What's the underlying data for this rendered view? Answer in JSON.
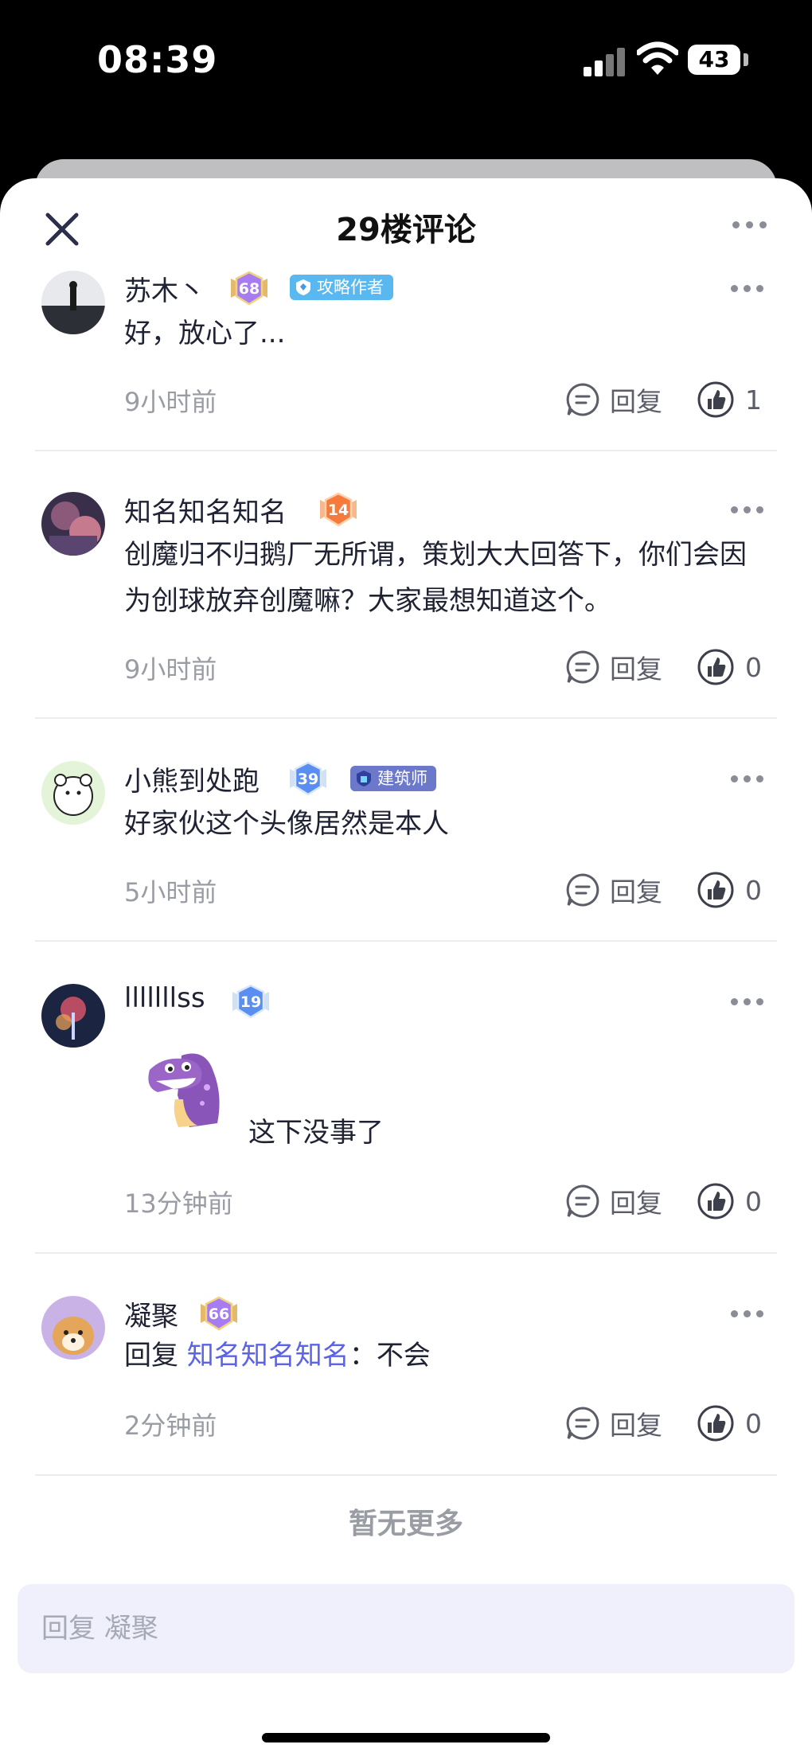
{
  "status_bar": {
    "time": "08:39",
    "battery": "43"
  },
  "header": {
    "title": "29楼评论"
  },
  "comments": [
    {
      "username": "苏木丶",
      "level": "68",
      "tag": "攻略作者",
      "text": "好，放心了...",
      "time": "9小时前",
      "reply_label": "回复",
      "likes": "1"
    },
    {
      "username": "知名知名知名",
      "level": "14",
      "text": "创魔归不归鹅厂无所谓，策划大大回答下，你们会因为创球放弃创魔嘛？大家最想知道这个。",
      "time": "9小时前",
      "reply_label": "回复",
      "likes": "0"
    },
    {
      "username": "小熊到处跑",
      "level": "39",
      "tag": "建筑师",
      "text": "好家伙这个头像居然是本人",
      "time": "5小时前",
      "reply_label": "回复",
      "likes": "0"
    },
    {
      "username": "lllllllss",
      "level": "19",
      "text": "这下没事了",
      "time": "13分钟前",
      "reply_label": "回复",
      "likes": "0"
    },
    {
      "username": "凝聚",
      "level": "66",
      "reply_prefix": "回复",
      "reply_to": "知名知名知名",
      "reply_sep": "：",
      "text": "不会",
      "time": "2分钟前",
      "reply_label": "回复",
      "likes": "0"
    }
  ],
  "footer": {
    "no_more": "暂无更多",
    "input_placeholder": "回复 凝聚"
  },
  "colors": {
    "accent": "#5b63e8",
    "tag_blue": "#5ab8f0",
    "level_purple": "#a77cf0",
    "level_orange": "#f57a3c"
  }
}
